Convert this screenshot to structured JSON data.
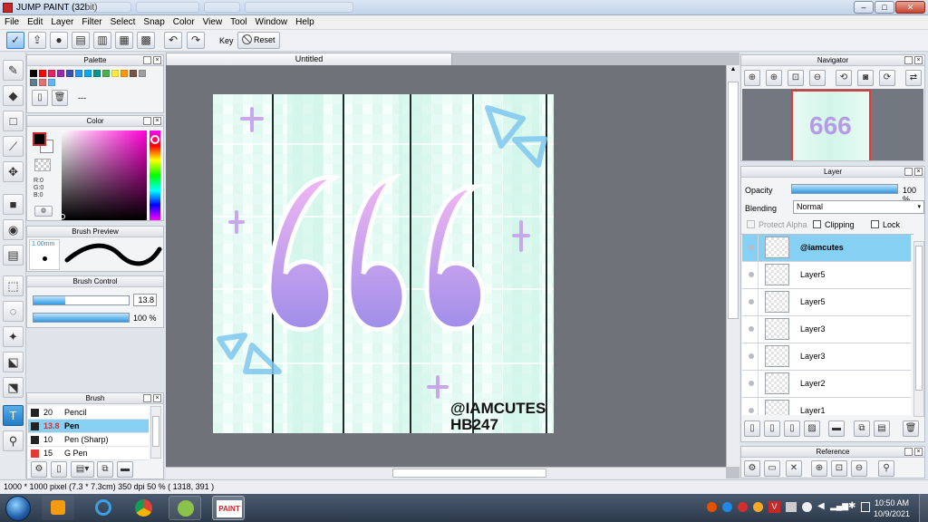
{
  "window": {
    "title": "JUMP PAINT (32bit)",
    "minimize": "–",
    "maximize": "□",
    "close": "✕"
  },
  "menu": [
    "File",
    "Edit",
    "Layer",
    "Filter",
    "Select",
    "Snap",
    "Color",
    "View",
    "Tool",
    "Window",
    "Help"
  ],
  "toolbar": {
    "key_label": "Key",
    "reset_label": "Reset"
  },
  "palette": {
    "title": "Palette",
    "swatches": [
      "#000000",
      "#ff0000",
      "#e91e63",
      "#9c27b0",
      "#3f51b5",
      "#2196f3",
      "#03a9f4",
      "#009688",
      "#4caf50",
      "#ffeb3b",
      "#ff9800",
      "#795548",
      "#9e9e9e",
      "#607d8b",
      "#e57373",
      "#64b5f6"
    ],
    "name_placeholder": "---"
  },
  "color": {
    "title": "Color",
    "r": "R:0",
    "g": "G:0",
    "b": "B:0"
  },
  "brush_preview": {
    "title": "Brush Preview",
    "size": "1.00mm"
  },
  "brush_control": {
    "title": "Brush Control",
    "size_value": "13.8",
    "opacity_value": "100 %",
    "size_fraction": 0.33,
    "opacity_fraction": 1.0
  },
  "brush": {
    "title": "Brush",
    "items": [
      {
        "size": "20",
        "name": "Pencil",
        "color": "#222222"
      },
      {
        "size": "13.8",
        "name": "Pen",
        "color": "#222222",
        "selected": true
      },
      {
        "size": "10",
        "name": "Pen (Sharp)",
        "color": "#222222"
      },
      {
        "size": "15",
        "name": "G Pen",
        "color": "#e53935"
      }
    ]
  },
  "document": {
    "tab_title": "Untitled"
  },
  "artwork": {
    "digits": "666",
    "signature_line1": "@IAMCUTES",
    "signature_line2": "HB247"
  },
  "navigator": {
    "title": "Navigator"
  },
  "layer": {
    "title": "Layer",
    "opacity_label": "Opacity",
    "opacity_value": "100 %",
    "opacity_fraction": 1.0,
    "blending_label": "Blending",
    "blending_value": "Normal",
    "protect_alpha": "Protect Alpha",
    "clipping": "Clipping",
    "lock": "Lock",
    "layers": [
      {
        "name": "@iamcutes",
        "selected": true
      },
      {
        "name": "Layer5"
      },
      {
        "name": "Layer5"
      },
      {
        "name": "Layer3"
      },
      {
        "name": "Layer3"
      },
      {
        "name": "Layer2"
      },
      {
        "name": "Layer1"
      }
    ]
  },
  "reference": {
    "title": "Reference"
  },
  "status": {
    "text": "1000 * 1000 pixel   (7.3 * 7.3cm)   350 dpi   50 %   ( 1318, 391 )"
  },
  "taskbar": {
    "time": "10:50 AM",
    "date": "10/9/2021",
    "paint_label": "PAINT"
  }
}
